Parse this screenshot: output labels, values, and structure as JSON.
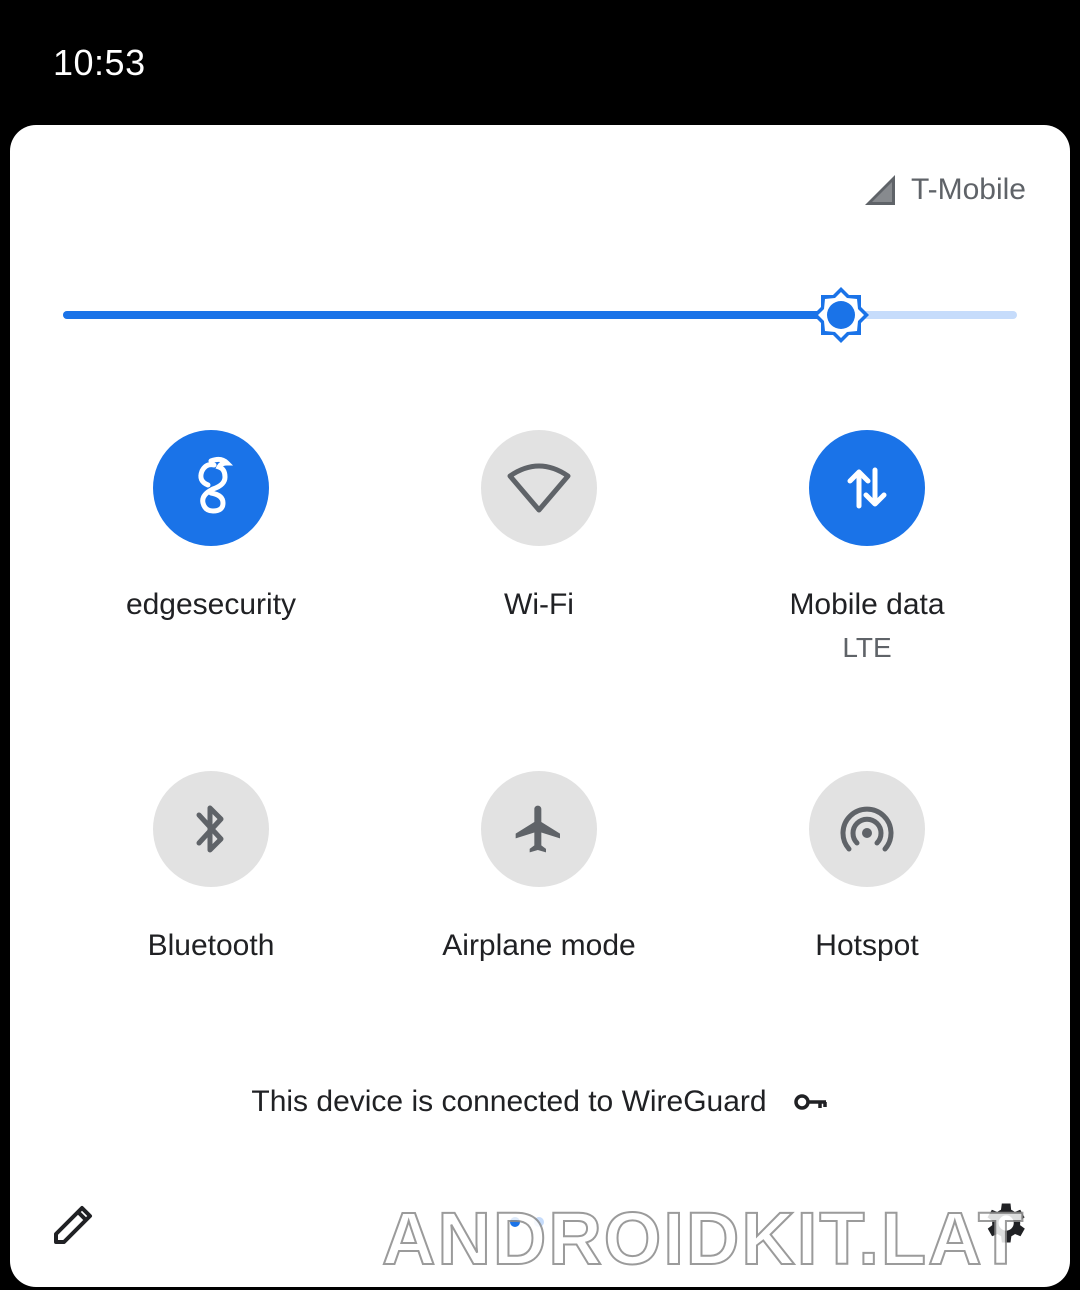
{
  "status_bar": {
    "time": "10:53"
  },
  "carrier": {
    "name": "T-Mobile",
    "icon": "signal-icon"
  },
  "brightness": {
    "level": 0.815,
    "icon": "brightness-icon"
  },
  "tiles": [
    {
      "label": "edgesecurity",
      "sublabel": "",
      "state": "on",
      "icon": "wireguard-icon"
    },
    {
      "label": "Wi-Fi",
      "sublabel": "",
      "state": "off",
      "icon": "wifi-icon"
    },
    {
      "label": "Mobile data",
      "sublabel": "LTE",
      "state": "on",
      "icon": "mobile-data-icon"
    },
    {
      "label": "Bluetooth",
      "sublabel": "",
      "state": "off",
      "icon": "bluetooth-icon"
    },
    {
      "label": "Airplane mode",
      "sublabel": "",
      "state": "off",
      "icon": "airplane-icon"
    },
    {
      "label": "Hotspot",
      "sublabel": "",
      "state": "off",
      "icon": "hotspot-icon"
    }
  ],
  "vpn_footer": {
    "text": "This device is connected to WireGuard",
    "icon": "key-icon"
  },
  "footer": {
    "edit_icon": "pencil-icon",
    "settings_icon": "gear-icon"
  },
  "watermark": "ANDROIDKIT.LAT",
  "colors": {
    "accent": "#1a73e8",
    "tile_off": "#e2e2e2",
    "track_light": "#c6dcfb"
  }
}
